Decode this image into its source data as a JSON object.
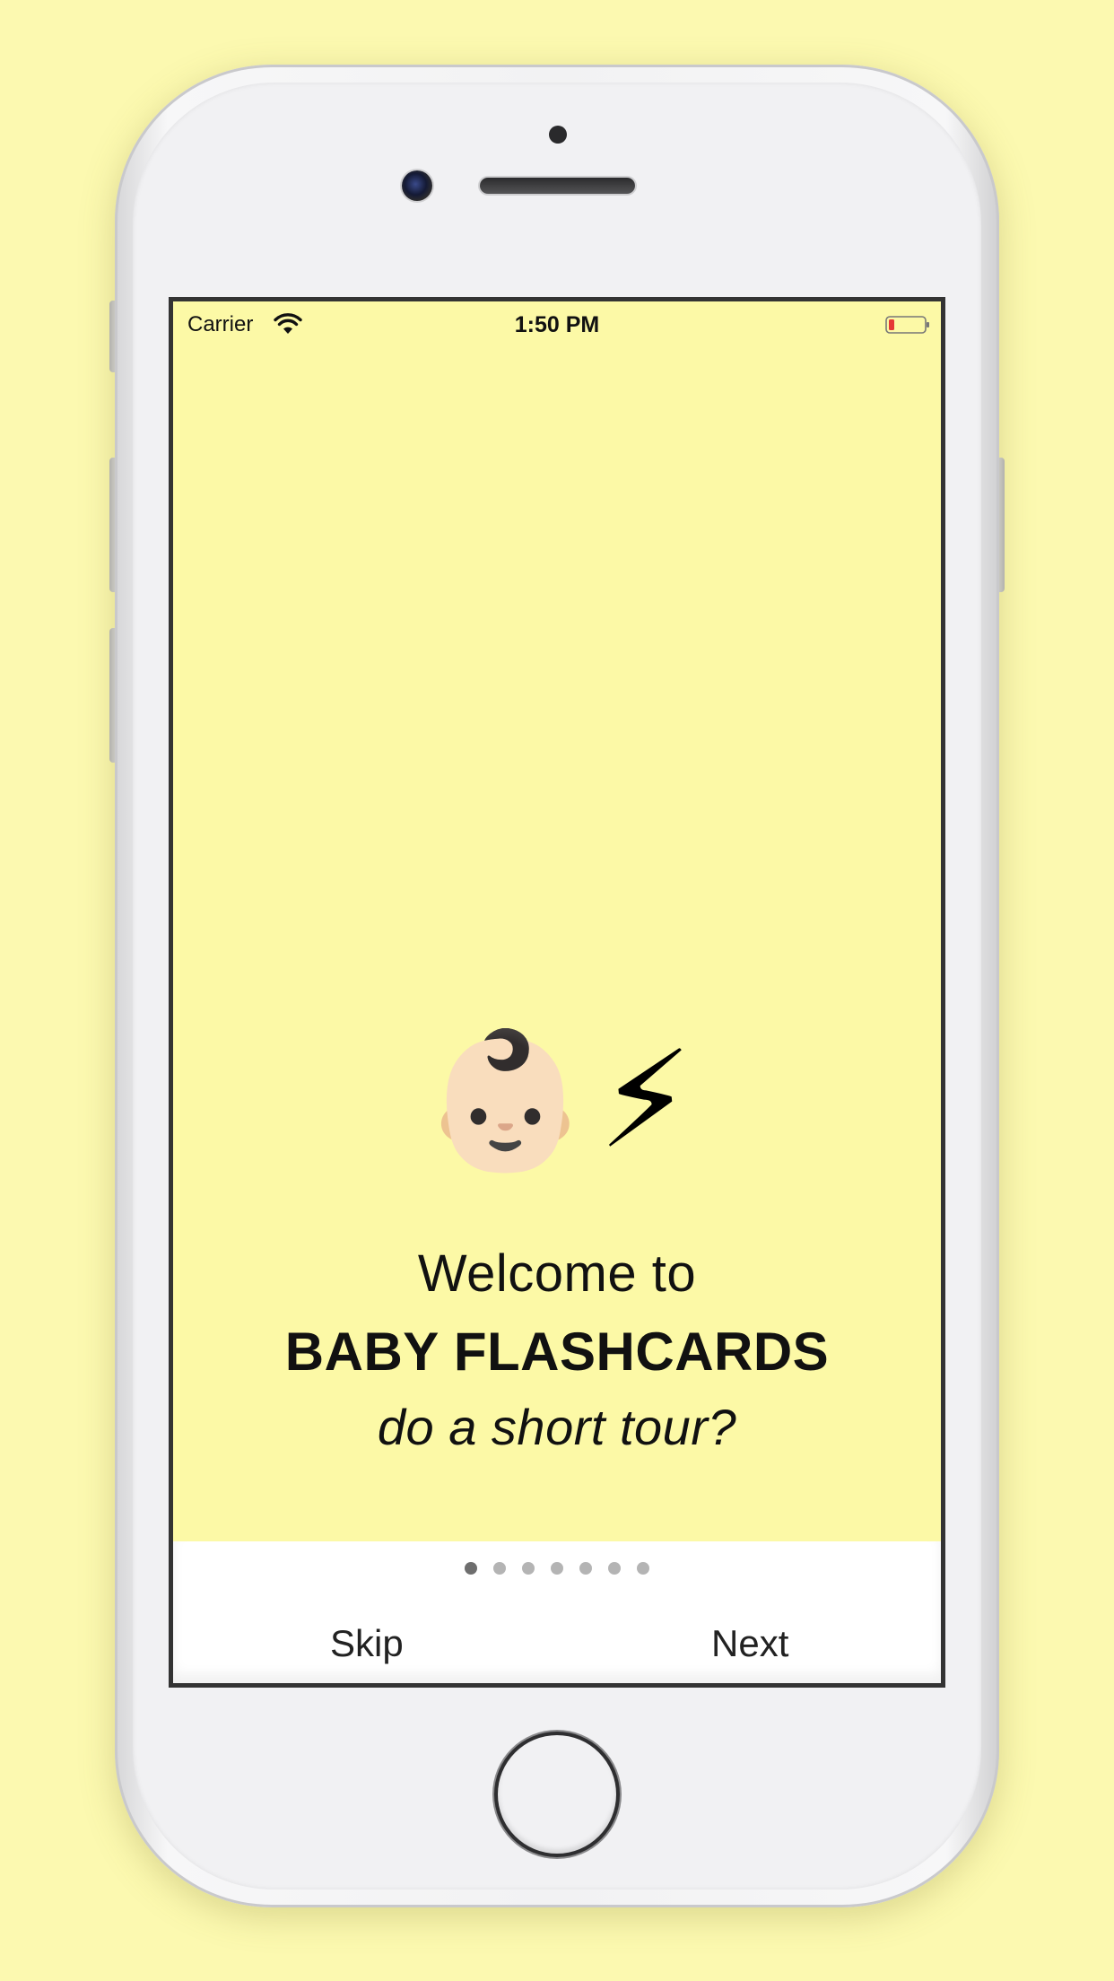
{
  "status_bar": {
    "carrier": "Carrier",
    "time": "1:50 PM",
    "wifi_icon": "wifi-icon",
    "battery_icon": "battery-low-icon",
    "battery_color": "#e53935"
  },
  "onboarding": {
    "emoji_baby": "👶🏻",
    "emoji_bolt": "⚡",
    "welcome": "Welcome to",
    "title": "BABY FLASHCARDS",
    "subtitle": "do a short tour?"
  },
  "pager": {
    "total_pages": 7,
    "current_page": 1
  },
  "actions": {
    "skip_label": "Skip",
    "next_label": "Next"
  },
  "colors": {
    "background": "#fcf9b0",
    "screen": "#fcf9a6",
    "bottom_bar": "#ffffff"
  }
}
